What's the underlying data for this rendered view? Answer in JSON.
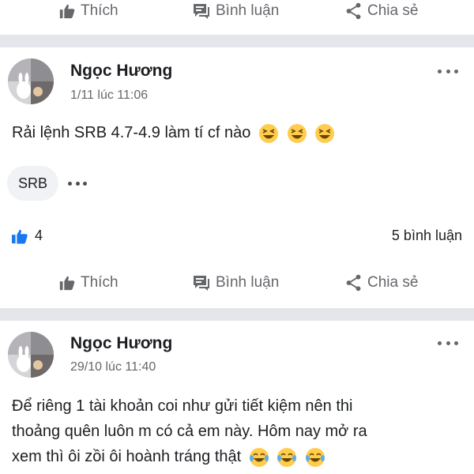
{
  "top_actions": {
    "like": "Thích",
    "comment": "Bình luận",
    "share": "Chia sẻ"
  },
  "posts": [
    {
      "author": "Ngọc Hương",
      "timestamp": "1/11 lúc 11:06",
      "text": "Rải lệnh SRB 4.7-4.9 làm tí cf nào",
      "emoji": [
        "😆",
        "😆",
        "😆"
      ],
      "tag": "SRB",
      "likes_count": "4",
      "comments_count": "5 bình luận",
      "actions": {
        "like": "Thích",
        "comment": "Bình luận",
        "share": "Chia sẻ"
      }
    },
    {
      "author": "Ngọc Hương",
      "timestamp": "29/10 lúc 11:40",
      "text_lines": [
        "Để riêng 1 tài khoản coi như gửi tiết kiệm nên thi",
        "thoảng quên luôn m có cả em này. Hôm nay mở ra",
        "xem thì ôi zồi ôi hoành tráng thật"
      ],
      "emoji": [
        "😂",
        "😂",
        "😂"
      ]
    }
  ],
  "colors": {
    "like_blue": "#1877f2",
    "secondary_text": "#65676b",
    "separator": "#e4e6eb",
    "emoji_yellow": "#ffcc4d"
  }
}
